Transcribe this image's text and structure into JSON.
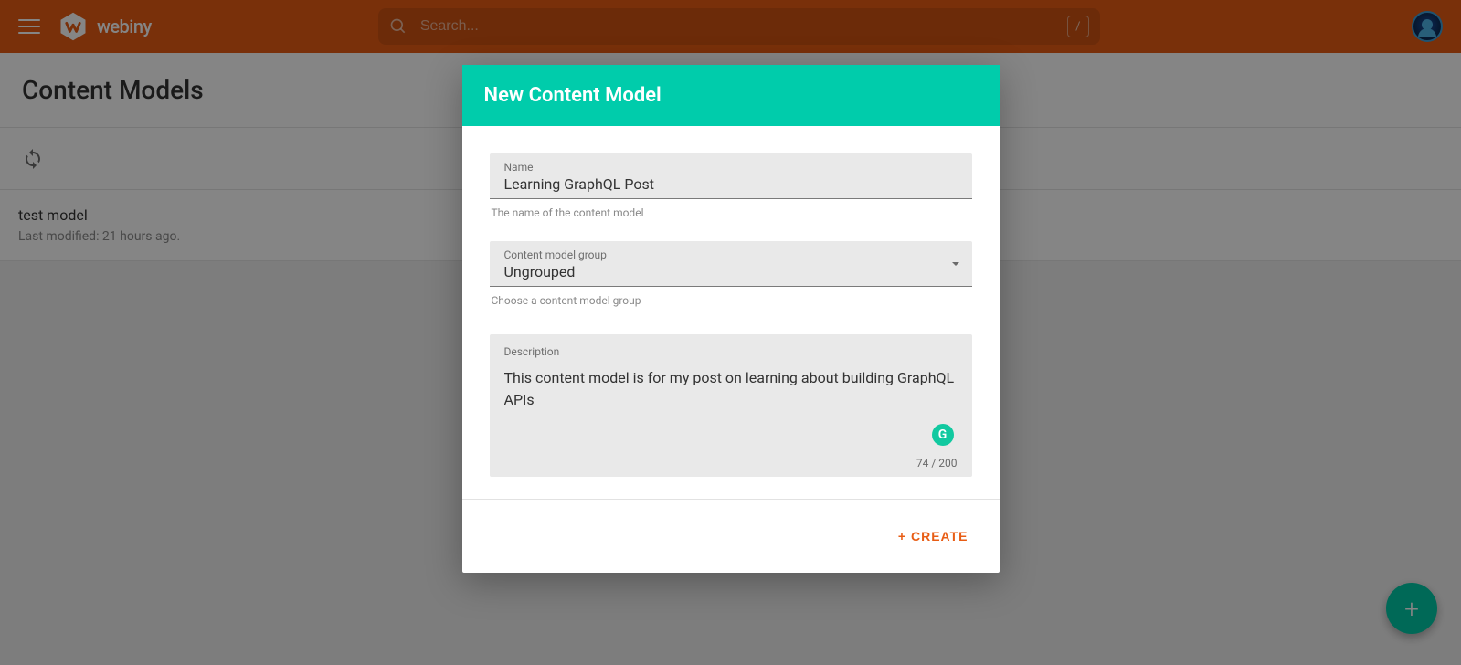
{
  "brand": {
    "name": "webiny"
  },
  "search": {
    "placeholder": "Search...",
    "shortcut": "/"
  },
  "pageTitle": "Content Models",
  "list": {
    "items": [
      {
        "title": "test model",
        "subtitle": "Last modified: 21 hours ago."
      }
    ]
  },
  "modal": {
    "title": "New Content Model",
    "name": {
      "label": "Name",
      "value": "Learning GraphQL Post",
      "helper": "The name of the content model"
    },
    "group": {
      "label": "Content model group",
      "value": "Ungrouped",
      "helper": "Choose a content model group"
    },
    "description": {
      "label": "Description",
      "value": "This content model is for my post on learning about building GraphQL APIs",
      "counter": "74 / 200"
    },
    "createLabel": "+ CREATE"
  },
  "fab": {
    "label": "+"
  },
  "icons": {
    "grammarly": "G"
  }
}
